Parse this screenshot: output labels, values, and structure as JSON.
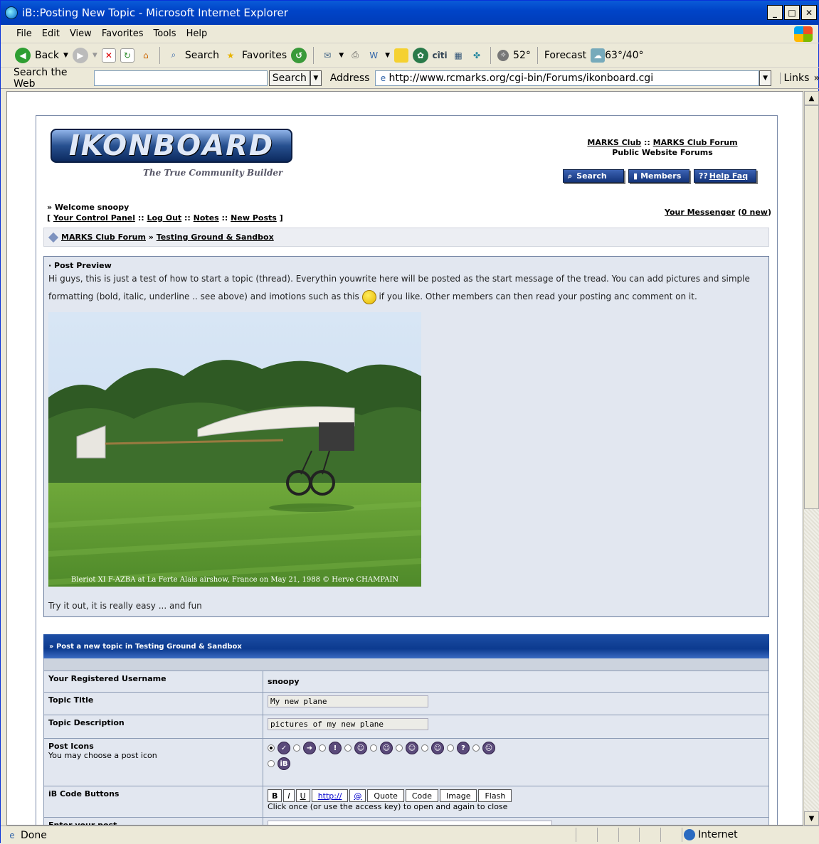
{
  "window": {
    "title": "iB::Posting New Topic - Microsoft Internet Explorer"
  },
  "menu": [
    "File",
    "Edit",
    "View",
    "Favorites",
    "Tools",
    "Help"
  ],
  "toolbar": {
    "back": "Back",
    "search": "Search",
    "favorites": "Favorites",
    "temp": "52°",
    "forecast": "Forecast",
    "forecast_temp": "63°/40°"
  },
  "addressbar": {
    "search_label": "Search the Web",
    "search_button": "Search",
    "address_label": "Address",
    "url": "http://www.rcmarks.org/cgi-bin/Forums/ikonboard.cgi",
    "links": "Links"
  },
  "status": {
    "left": "Done",
    "zone": "Internet"
  },
  "forum": {
    "logo_text": "IKONBOARD",
    "tagline": "The True Community Builder",
    "club": "MARKS Club",
    "club_forum": "MARKS Club Forum",
    "subtitle": "Public Website Forums",
    "nav": {
      "search": "Search",
      "members": "Members",
      "help": "Help Faq"
    },
    "welcome": "» Welcome snoopy",
    "links": {
      "control_panel": "Your Control Panel",
      "logout": "Log Out",
      "notes": "Notes",
      "new_posts": "New Posts"
    },
    "messenger": "Your Messenger",
    "messenger_count": "0 new",
    "breadcrumb": {
      "forum": "MARKS Club Forum",
      "section": "Testing Ground & Sandbox"
    },
    "preview": {
      "heading": "· Post Preview",
      "text1": "Hi guys, this is just a test of how to start a topic (thread). Everythin youwrite here will be posted as the start message of the tread. You can add pictures and simple formatting (bold, italic, underline .. see above) and imotions such as this",
      "text2": "if you like. Other members can then read your posting anc comment on it.",
      "caption": "Bleriot XI F-AZBA at La Ferte Alais airshow, France on May 21, 1988 © Herve CHAMPAIN",
      "footer": "Try it out, it is really easy ... and fun"
    },
    "form": {
      "title": "» Post a new topic in Testing Ground & Sandbox",
      "username_label": "Your Registered Username",
      "username": "snoopy",
      "topic_title_label": "Topic Title",
      "topic_title": "My new plane",
      "topic_desc_label": "Topic Description",
      "topic_desc": "pictures of my new plane",
      "post_icons_label": "Post Icons",
      "post_icons_hint": "You may choose a post icon",
      "ibcode_label": "iB Code Buttons",
      "ibcode_buttons": [
        "B",
        "I",
        "U",
        "http://",
        "@",
        "Quote",
        "Code",
        "Image",
        "Flash"
      ],
      "ibcode_hint": "Click once (or use the access key) to open and again to close",
      "enter_post_label": "Enter your post"
    }
  }
}
